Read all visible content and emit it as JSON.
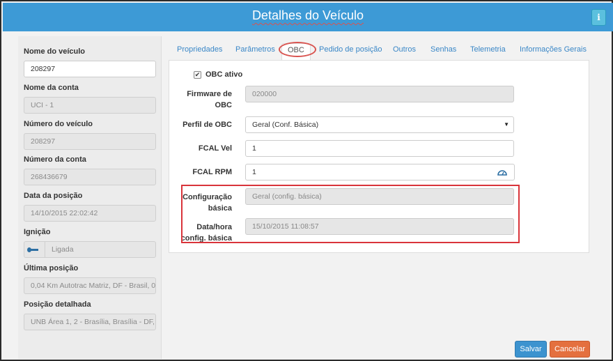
{
  "header": {
    "title": "Detalhes do Veículo",
    "info_label": "i"
  },
  "left": {
    "nome_veiculo": {
      "label": "Nome do veículo",
      "value": "208297"
    },
    "nome_conta": {
      "label": "Nome da conta",
      "value": "UCI - 1"
    },
    "numero_veiculo": {
      "label": "Número do veículo",
      "value": "208297"
    },
    "numero_conta": {
      "label": "Número da conta",
      "value": "268436679"
    },
    "data_posicao": {
      "label": "Data da posição",
      "value": "14/10/2015 22:02:42"
    },
    "ignicao": {
      "label": "Ignição",
      "value": "Ligada",
      "icon": "key-icon"
    },
    "ultima_posicao": {
      "label": "Última posição",
      "value": "0,04 Km Autotrac Matriz, DF - Brasil, 0."
    },
    "posicao_detalhada": {
      "label": "Posição detalhada",
      "value": "UNB Área 1, 2 - Brasília, Brasília - DF,"
    }
  },
  "tabs": [
    {
      "label": "Propriedades"
    },
    {
      "label": "Parâmetros"
    },
    {
      "label": "OBC"
    },
    {
      "label": "Pedido de posição"
    },
    {
      "label": "Outros"
    },
    {
      "label": "Senhas"
    },
    {
      "label": "Telemetria"
    },
    {
      "label": "Informações Gerais"
    }
  ],
  "obc": {
    "ativo": {
      "label": "OBC ativo",
      "checked": true,
      "mark": "✔"
    },
    "firmware": {
      "label_line1": "Firmware de",
      "label_line2": "OBC",
      "value": "020000"
    },
    "perfil": {
      "label": "Perfil de OBC",
      "value": "Geral (Conf. Básica)",
      "arrow": "▼"
    },
    "fcal_vel": {
      "label": "FCAL Vel",
      "value": "1"
    },
    "fcal_rpm": {
      "label": "FCAL RPM",
      "value": "1",
      "icon": "gauge-icon"
    },
    "config_basica": {
      "label_line1": "Configuração",
      "label_line2": "básica",
      "value": "Geral (config. básica)"
    },
    "data_hora": {
      "label_line1": "Data/hora",
      "label_line2": "config. básica",
      "value": "15/10/2015 11:08:57"
    }
  },
  "footer": {
    "save_label": "Salvar",
    "cancel_label": "Cancelar"
  },
  "colors": {
    "header_bg": "#3d9ad6",
    "save_bg": "#3c93cf",
    "cancel_bg": "#e4703f",
    "highlight": "#d9343a"
  }
}
